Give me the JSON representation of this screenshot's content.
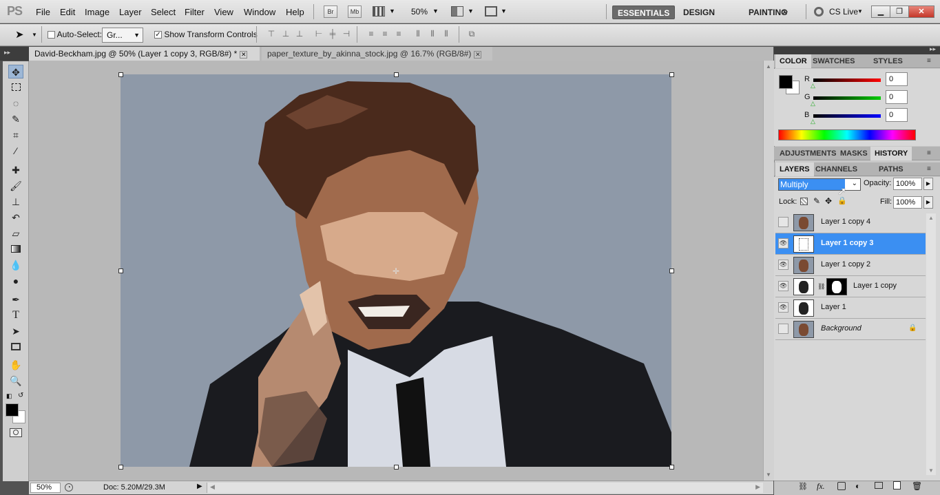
{
  "app": {
    "logo": "PS"
  },
  "menu": [
    "File",
    "Edit",
    "Image",
    "Layer",
    "Select",
    "Filter",
    "View",
    "Window",
    "Help"
  ],
  "appbar": {
    "br": "Br",
    "mb": "Mb",
    "zoom": "50%"
  },
  "workspaces": [
    "ESSENTIALS",
    "DESIGN",
    "PAINTING"
  ],
  "cslive": "CS Live",
  "options": {
    "auto_select_label": "Auto-Select:",
    "auto_select_value": "Gr...",
    "show_transform_label": "Show Transform Controls"
  },
  "doc_tabs": [
    {
      "label": "David-Beckham.jpg @ 50% (Layer 1 copy 3, RGB/8#) *"
    },
    {
      "label": "paper_texture_by_akinna_stock.jpg @ 16.7% (RGB/8#)"
    }
  ],
  "status": {
    "zoom": "50%",
    "doc": "Doc: 5.20M/29.3M"
  },
  "color_panel": {
    "tabs": [
      "COLOR",
      "SWATCHES",
      "STYLES"
    ],
    "r_label": "R",
    "g_label": "G",
    "b_label": "B",
    "r": "0",
    "g": "0",
    "b": "0",
    "foreground": "#000000",
    "background": "#ffffff"
  },
  "adjust_tabs": [
    "ADJUSTMENTS",
    "MASKS",
    "HISTORY"
  ],
  "layers_panel": {
    "tabs": [
      "LAYERS",
      "CHANNELS",
      "PATHS"
    ],
    "blend_mode": "Multiply",
    "opacity_label": "Opacity:",
    "opacity": "100%",
    "lock_label": "Lock:",
    "fill_label": "Fill:",
    "fill": "100%",
    "layers": [
      {
        "name": "Layer 1 copy 4",
        "visible": false,
        "selected": false
      },
      {
        "name": "Layer 1 copy 3",
        "visible": true,
        "selected": true
      },
      {
        "name": "Layer 1 copy 2",
        "visible": true,
        "selected": false
      },
      {
        "name": "Layer 1 copy",
        "visible": true,
        "selected": false,
        "has_mask": true
      },
      {
        "name": "Layer 1",
        "visible": true,
        "selected": false
      },
      {
        "name": "Background",
        "visible": false,
        "selected": false,
        "locked": true
      }
    ]
  },
  "colors": {
    "accent": "#3b8ff2",
    "canvas_bg": "#8e99a8"
  }
}
